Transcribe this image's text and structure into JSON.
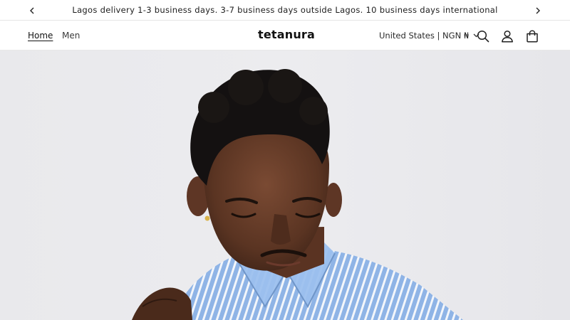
{
  "announcement": {
    "message": "Lagos delivery 1-3 business days. 3-7 business days outside Lagos. 10 business days international",
    "prev_icon": "chevron-left-icon",
    "next_icon": "chevron-right-icon"
  },
  "header": {
    "nav": [
      {
        "label": "Home",
        "active": true
      },
      {
        "label": "Men",
        "active": false
      }
    ],
    "logo": "tetanura",
    "country_selector": "United States | NGN ₦",
    "icons": [
      "search-icon",
      "account-icon",
      "cart-icon"
    ]
  },
  "hero": {
    "image": "model-portrait-blue-striped-shirt",
    "background_color": "#eaeaed",
    "shirt_color": "#8fb4e6"
  }
}
